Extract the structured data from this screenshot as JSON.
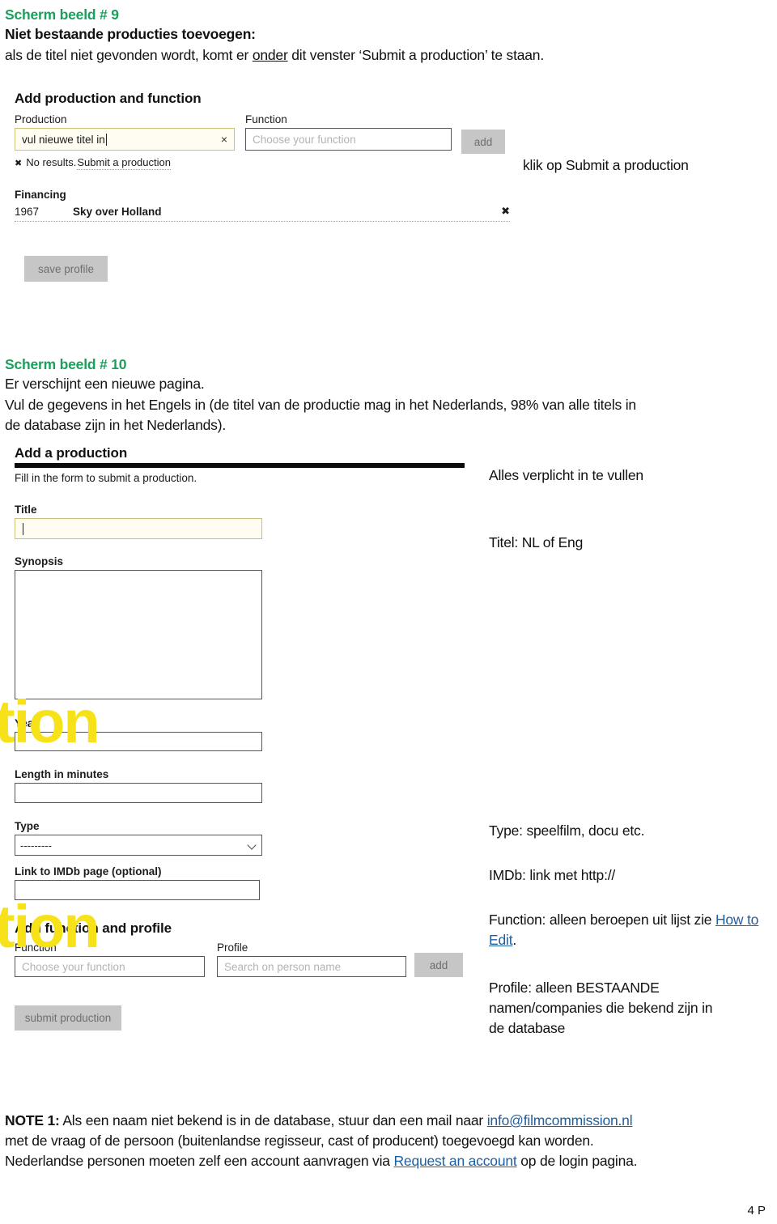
{
  "document": {
    "section1": {
      "heading": "Scherm beeld # 9",
      "subheading": "Niet bestaande producties toevoegen:",
      "body_a": "als de titel niet gevonden wordt, komt er ",
      "body_underlined": "onder",
      "body_b": " dit venster ‘Submit a production’ te staan."
    },
    "section2": {
      "heading": "Scherm beeld # 10",
      "line1": "Er verschijnt een nieuwe pagina.",
      "line2": "Vul de gegevens in het Engels in (de titel van de productie mag in het Nederlands, 98% van alle titels in",
      "line3": "de database zijn in het Nederlands)."
    },
    "note": {
      "label": "NOTE 1:",
      "part1": " Als een naam niet bekend is in de database, stuur dan een mail naar ",
      "email_link": "info@filmcommission.nl",
      "part2": "met de vraag of de persoon (buitenlandse regisseur, cast of producent) toegevoegd kan worden.",
      "part3a": "Nederlandse personen moeten zelf een account aanvragen via ",
      "account_link": "Request an account",
      "part3b": " op de login pagina."
    },
    "footer": "4 P",
    "watermark_text": "tion"
  },
  "annotations": {
    "klik_submit": "klik op Submit a production",
    "alles_verplicht": "Alles verplicht in te vullen",
    "titel": "Titel: NL of Eng",
    "type": "Type: speelfilm, docu etc.",
    "imdb": "IMDb: link met http://",
    "function_a": "Function: alleen beroepen uit lijst zie ",
    "function_link": "How to Edit",
    "function_b": ".",
    "profile_line1": "Profile: alleen BESTAANDE",
    "profile_line2": "namen/companies die bekend zijn in",
    "profile_line3": "de database"
  },
  "screenshot9": {
    "title": "Add production and function",
    "production_label": "Production",
    "production_value": "vul nieuwe titel in",
    "clear_icon": "×",
    "function_label": "Function",
    "function_placeholder": "Choose your function",
    "add_button": "add",
    "no_results_icon": "✖",
    "no_results_text": "No results. ",
    "no_results_link": "Submit a production",
    "financing_label": "Financing",
    "financing_row": {
      "year": "1967",
      "name": "Sky over Holland",
      "remove_icon": "✖"
    },
    "save_button": "save profile"
  },
  "screenshot10": {
    "title": "Add a production",
    "subtitle": "Fill in the form to submit a production.",
    "fields": {
      "title_label": "Title",
      "title_value": "",
      "synopsis_label": "Synopsis",
      "synopsis_value": "",
      "year_label": "Year",
      "year_value": "",
      "length_label": "Length in minutes",
      "length_value": "",
      "type_label": "Type",
      "type_value": "---------",
      "imdb_label": "Link to IMDb page (optional)",
      "imdb_value": ""
    },
    "function_section": {
      "title": "Add function and profile",
      "function_label": "Function",
      "function_placeholder": "Choose your function",
      "profile_label": "Profile",
      "profile_placeholder": "Search on person name",
      "add_button": "add"
    },
    "submit_button": "submit production"
  },
  "colors": {
    "heading_green": "#1aa05c",
    "link_blue": "#1f5fa0",
    "watermark_yellow": "#f7e21a",
    "button_gray": "#c6c6c6"
  }
}
